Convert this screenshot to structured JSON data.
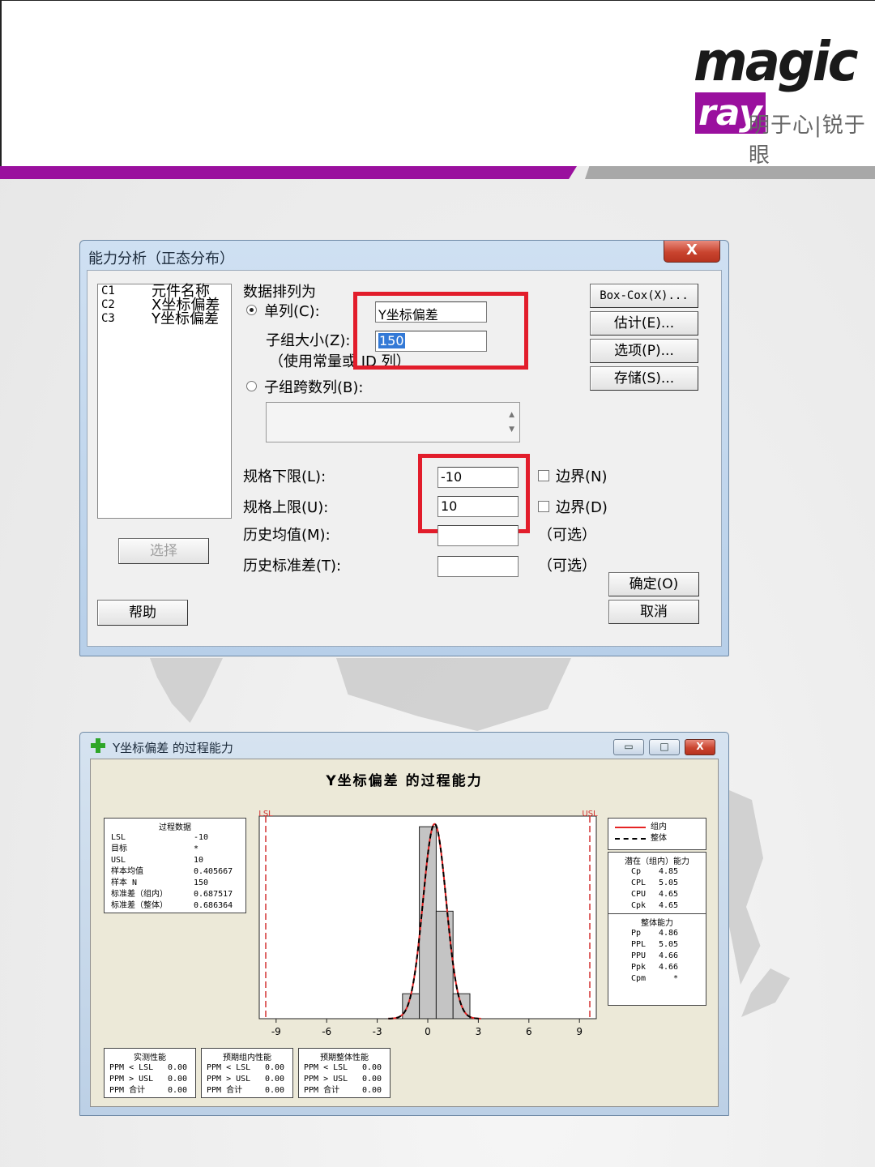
{
  "slide": {
    "logo": {
      "brand": "magic",
      "brand_accent": "ray",
      "slogan": "明于心|锐于眼"
    },
    "colors": {
      "purple": "#9a109e",
      "gray": "#a8a8a8",
      "red_box": "#e21d2b"
    }
  },
  "dialog": {
    "title": "能力分析（正态分布）",
    "close_label": "X",
    "columns": [
      {
        "id": "C1",
        "name": "元件名称"
      },
      {
        "id": "C2",
        "name": "X坐标偏差"
      },
      {
        "id": "C3",
        "name": "Y坐标偏差"
      }
    ],
    "data_arranged_label": "数据排列为",
    "single_column_label": "单列(C):",
    "single_column_value": "Y坐标偏差",
    "subgroup_size_label": "子组大小(Z):",
    "subgroup_size_value": "150",
    "subgroup_hint": "（使用常量或 ID 列）",
    "subgroups_across_label": "子组跨数列(B):",
    "lsl_label": "规格下限(L):",
    "lsl_value": "-10",
    "usl_label": "规格上限(U):",
    "usl_value": "10",
    "boundary_lower_label": "边界(N)",
    "boundary_upper_label": "边界(D)",
    "hist_mean_label": "历史均值(M):",
    "hist_std_label": "历史标准差(T):",
    "optional_label": "（可选）",
    "select_button": "选择",
    "help_button": "帮助",
    "boxcox_button": "Box-Cox(X)...",
    "estimate_button": "估计(E)...",
    "options_button": "选项(P)...",
    "storage_button": "存储(S)...",
    "ok_button": "确定(O)",
    "cancel_button": "取消"
  },
  "report": {
    "window_title": "Y坐标偏差 的过程能力",
    "minimize": "▭",
    "maximize": "□",
    "close": "X",
    "process_data": {
      "header": "过程数据",
      "rows": [
        {
          "k": "LSL",
          "v": "-10"
        },
        {
          "k": "目标",
          "v": "*"
        },
        {
          "k": "USL",
          "v": "10"
        },
        {
          "k": "样本均值",
          "v": "0.405667"
        },
        {
          "k": "样本 N",
          "v": "150"
        },
        {
          "k": "标准差（组内）",
          "v": "0.687517"
        },
        {
          "k": "标准差（整体）",
          "v": "0.686364"
        }
      ]
    },
    "legend": {
      "within": "组内",
      "overall": "整体"
    },
    "potential": {
      "header": "潜在（组内）能力",
      "rows": [
        {
          "k": "Cp",
          "v": "4.85"
        },
        {
          "k": "CPL",
          "v": "5.05"
        },
        {
          "k": "CPU",
          "v": "4.65"
        },
        {
          "k": "Cpk",
          "v": "4.65"
        }
      ]
    },
    "overall_cap": {
      "header": "整体能力",
      "rows": [
        {
          "k": "Pp",
          "v": "4.86"
        },
        {
          "k": "PPL",
          "v": "5.05"
        },
        {
          "k": "PPU",
          "v": "4.66"
        },
        {
          "k": "Ppk",
          "v": "4.66"
        },
        {
          "k": "Cpm",
          "v": "*"
        }
      ]
    },
    "observed": {
      "header": "实测性能",
      "rows": [
        {
          "k": "PPM < LSL",
          "v": "0.00"
        },
        {
          "k": "PPM > USL",
          "v": "0.00"
        },
        {
          "k": "PPM 合计",
          "v": "0.00"
        }
      ]
    },
    "exp_within": {
      "header": "预期组内性能",
      "rows": [
        {
          "k": "PPM < LSL",
          "v": "0.00"
        },
        {
          "k": "PPM > USL",
          "v": "0.00"
        },
        {
          "k": "PPM 合计",
          "v": "0.00"
        }
      ]
    },
    "exp_overall": {
      "header": "预期整体性能",
      "rows": [
        {
          "k": "PPM < LSL",
          "v": "0.00"
        },
        {
          "k": "PPM > USL",
          "v": "0.00"
        },
        {
          "k": "PPM 合计",
          "v": "0.00"
        }
      ]
    }
  },
  "chart_data": {
    "type": "bar",
    "title": "Y坐标偏差 的过程能力",
    "spec_labels": {
      "lsl": "LSL",
      "usl": "USL"
    },
    "lsl": -10,
    "usl": 10,
    "xlim": [
      -10,
      10
    ],
    "xticks": [
      -9,
      -6,
      -3,
      0,
      3,
      6,
      9
    ],
    "bin_width": 1,
    "bins": [
      {
        "center": -1,
        "height": 0.13
      },
      {
        "center": 0,
        "height": 1.0
      },
      {
        "center": 1,
        "height": 0.56
      },
      {
        "center": 2,
        "height": 0.13
      }
    ],
    "ymax": 1.03,
    "mean": 0.405667,
    "sd_within": 0.687517,
    "sd_overall": 0.686364,
    "colors": {
      "bars": "#c4c4c4",
      "within": "#e52424",
      "overall": "#000000",
      "spec": "#d43232"
    }
  }
}
